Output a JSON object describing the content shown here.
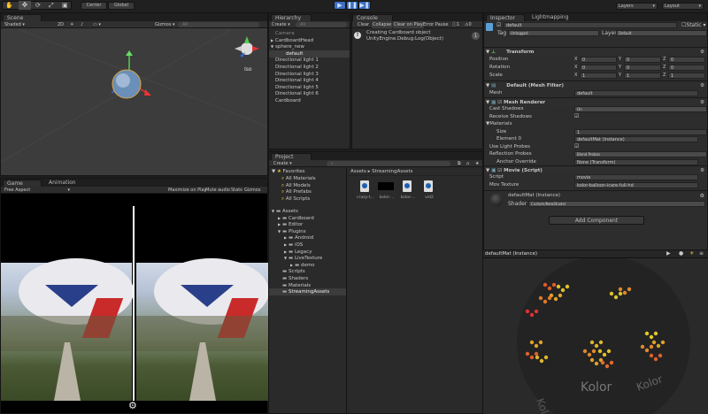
{
  "toolbar": {
    "tools": [
      "hand",
      "move",
      "rotate",
      "scale",
      "rect"
    ],
    "pivot": "Center",
    "space": "Global",
    "play_controls": [
      "play",
      "pause",
      "step"
    ],
    "layers": "Layers",
    "layout": "Layout"
  },
  "scene": {
    "tab": "Scene",
    "shading": "Shaded",
    "mode_2d": "2D",
    "gizmos": "Gizmos",
    "search": "All",
    "persp_label": "Iso"
  },
  "game": {
    "tabs": [
      "Game",
      "Animation"
    ],
    "aspect": "Free Aspect",
    "options": [
      "Maximize on Play",
      "Mute audio",
      "Stats",
      "Gizmos"
    ]
  },
  "hierarchy": {
    "tab": "Hierarchy",
    "create": "Create",
    "search": "All",
    "items": [
      {
        "label": "Camera",
        "indent": 0,
        "arrow": ""
      },
      {
        "label": "CardboardHead",
        "indent": 0,
        "arrow": "▶"
      },
      {
        "label": "sphere_new",
        "indent": 0,
        "arrow": "▼"
      },
      {
        "label": "default",
        "indent": 1,
        "arrow": "",
        "selected": true
      },
      {
        "label": "Directional light 1",
        "indent": 0,
        "arrow": ""
      },
      {
        "label": "Directional light 2",
        "indent": 0,
        "arrow": ""
      },
      {
        "label": "Directional light 3",
        "indent": 0,
        "arrow": ""
      },
      {
        "label": "Directional light 4",
        "indent": 0,
        "arrow": ""
      },
      {
        "label": "Directional light 5",
        "indent": 0,
        "arrow": ""
      },
      {
        "label": "Directional light 6",
        "indent": 0,
        "arrow": ""
      },
      {
        "label": "Cardboard",
        "indent": 0,
        "arrow": ""
      }
    ]
  },
  "console": {
    "tab": "Console",
    "buttons": [
      "Clear",
      "Collapse",
      "Clear on Play",
      "Error Pause"
    ],
    "counts": {
      "info": "1",
      "warn": "0"
    },
    "message_line1": "Creating Cardboard object",
    "message_line2": "UnityEngine.Debug:Log(Object)",
    "message_count": "1"
  },
  "project": {
    "tab": "Project",
    "create": "Create",
    "breadcrumb": [
      "Assets",
      "StreamingAssets"
    ],
    "favorites": {
      "label": "Favorites",
      "items": [
        "All Materials",
        "All Models",
        "All Prefabs",
        "All Scripts"
      ]
    },
    "tree": [
      {
        "label": "Assets",
        "indent": 0,
        "arrow": "▼"
      },
      {
        "label": "Cardboard",
        "indent": 1,
        "arrow": "▶"
      },
      {
        "label": "Editor",
        "indent": 1,
        "arrow": "▶"
      },
      {
        "label": "Plugins",
        "indent": 1,
        "arrow": "▼"
      },
      {
        "label": "Android",
        "indent": 2,
        "arrow": "▶"
      },
      {
        "label": "iOS",
        "indent": 2,
        "arrow": "▶"
      },
      {
        "label": "Legacy",
        "indent": 2,
        "arrow": "▶"
      },
      {
        "label": "LiveTexture",
        "indent": 2,
        "arrow": "▼"
      },
      {
        "label": "demo",
        "indent": 3,
        "arrow": "▶"
      },
      {
        "label": "Scripts",
        "indent": 1,
        "arrow": ""
      },
      {
        "label": "Shaders",
        "indent": 1,
        "arrow": ""
      },
      {
        "label": "Materials",
        "indent": 1,
        "arrow": ""
      },
      {
        "label": "StreamingAssets",
        "indent": 1,
        "arrow": "",
        "selected": true
      }
    ],
    "assets": [
      {
        "label": "crazy-t...",
        "kind": "video"
      },
      {
        "label": "kolor-...",
        "kind": "black"
      },
      {
        "label": "kolor-...",
        "kind": "video"
      },
      {
        "label": "vid2",
        "kind": "video"
      }
    ]
  },
  "inspector": {
    "tabs": [
      "Inspector",
      "Lightmapping"
    ],
    "object_name": "default",
    "static_label": "Static",
    "tag_label": "Tag",
    "tag": "Untagged",
    "layer_label": "Layer",
    "layer": "Default",
    "transform": {
      "title": "Transform",
      "rows": [
        {
          "label": "Position",
          "x": "0",
          "y": "0",
          "z": "0"
        },
        {
          "label": "Rotation",
          "x": "0",
          "y": "0",
          "z": "0"
        },
        {
          "label": "Scale",
          "x": "1",
          "y": "1",
          "z": "1"
        }
      ]
    },
    "mesh_filter": {
      "title": "Default (Mesh Filter)",
      "mesh_label": "Mesh",
      "mesh": "default"
    },
    "mesh_renderer": {
      "title": "Mesh Renderer",
      "cast_shadows_label": "Cast Shadows",
      "cast_shadows": "On",
      "receive_shadows_label": "Receive Shadows",
      "materials_label": "Materials",
      "size_label": "Size",
      "size": "1",
      "element0_label": "Element 0",
      "element0": "defaultMat (Instance)",
      "light_probes_label": "Use Light Probes",
      "reflection_label": "Reflection Probes",
      "reflection": "Blend Probes",
      "anchor_label": "Anchor Override",
      "anchor": "None (Transform)"
    },
    "movie": {
      "title": "Movie (Script)",
      "script_label": "Script",
      "script": "movie",
      "tex_label": "Mov Texture",
      "tex": "kolor-balloon-icare-full-hd"
    },
    "material": {
      "title": "defaultMat (Instance)",
      "shader_label": "Shader",
      "shader": "Custom/NewShader"
    },
    "add_component": "Add Component"
  },
  "preview": {
    "title": "defaultMat (Instance)",
    "logo_text": "Kolor"
  },
  "colors": {
    "accent": "#3d6fc2",
    "selection": "#3e5f96",
    "panel": "#2a2a2a"
  }
}
